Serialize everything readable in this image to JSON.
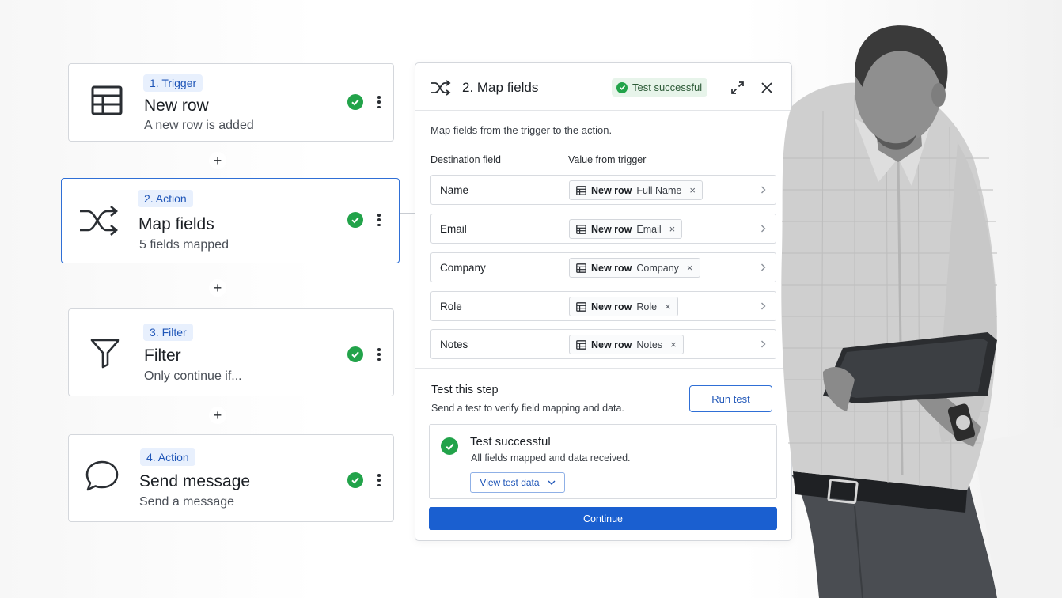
{
  "steps": [
    {
      "badge": "1. Trigger",
      "title": "New row",
      "subtitle": "A new row is added",
      "icon": "table-icon"
    },
    {
      "badge": "2. Action",
      "title": "Map fields",
      "subtitle": "5 fields mapped",
      "icon": "shuffle-icon"
    },
    {
      "badge": "3. Filter",
      "title": "Filter",
      "subtitle": "Only continue if...",
      "icon": "filter-icon"
    },
    {
      "badge": "4. Action",
      "title": "Send message",
      "subtitle": "Send a message",
      "icon": "chat-bubble-icon"
    }
  ],
  "connector_symbol": "+",
  "panel": {
    "title": "2. Map fields",
    "status_pill": "Test successful",
    "description": "Map fields from the trigger to the action.",
    "col_destination": "Destination field",
    "col_value": "Value from trigger",
    "fields": [
      {
        "name": "Name",
        "source": "New row",
        "value": "Full Name"
      },
      {
        "name": "Email",
        "source": "New row",
        "value": "Email"
      },
      {
        "name": "Company",
        "source": "New row",
        "value": "Company"
      },
      {
        "name": "Role",
        "source": "New row",
        "value": "Role"
      },
      {
        "name": "Notes",
        "source": "New row",
        "value": "Notes"
      }
    ],
    "remove_symbol": "×",
    "test_title": "Test this step",
    "test_desc": "Send a test to verify field mapping and data.",
    "run_test_label": "Run test",
    "result_title": "Test successful",
    "result_desc": "All fields mapped and data received.",
    "view_test_label": "View test data",
    "continue_label": "Continue"
  },
  "colors": {
    "accent": "#1a5fd0",
    "success": "#22a34a",
    "badge_bg": "#e8f0fd"
  }
}
